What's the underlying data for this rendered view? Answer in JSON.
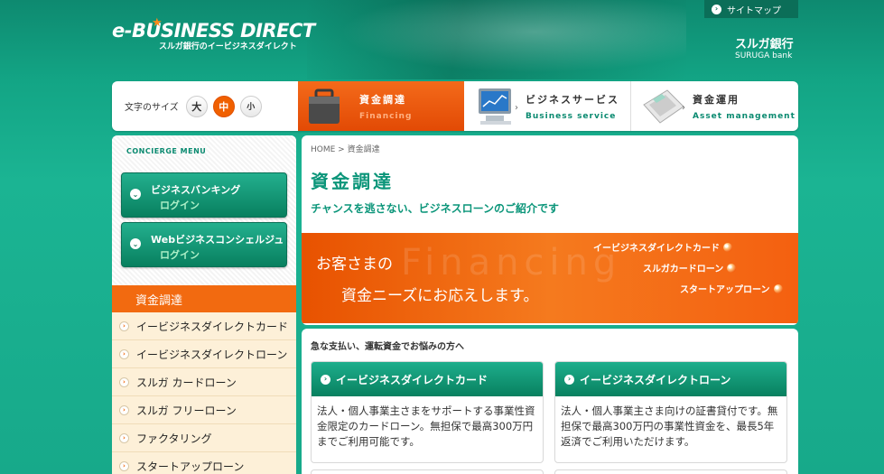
{
  "header": {
    "logo_main": "e-BUSINESS DIRECT",
    "logo_sub": "スルガ銀行のイービジネスダイレクト",
    "sitemap_label": "サイトマップ",
    "bank_name_jp": "スルガ銀行",
    "bank_name_en": "SURUGA bank"
  },
  "font_size": {
    "label": "文字のサイズ",
    "large": "大",
    "medium": "中",
    "small": "小",
    "selected": "中"
  },
  "nav": {
    "tabs": [
      {
        "jp": "資金調達",
        "en": "Financing",
        "active": true
      },
      {
        "jp": "ビジネスサービス",
        "en": "Business service",
        "active": false
      },
      {
        "jp": "資金運用",
        "en": "Asset management",
        "active": false
      }
    ]
  },
  "sidebar": {
    "concierge_title": "CONCIERGE MENU",
    "logins": [
      {
        "name": "ビジネスバンキング",
        "sub": "ログイン"
      },
      {
        "name": "Webビジネスコンシェルジュ",
        "sub": "ログイン"
      }
    ],
    "active_section": "資金調達",
    "items": [
      "イービジネスダイレクトカード",
      "イービジネスダイレクトローン",
      "スルガ カードローン",
      "スルガ フリーローン",
      "ファクタリング",
      "スタートアップローン"
    ]
  },
  "main": {
    "breadcrumb": "HOME > 資金調達",
    "title": "資金調達",
    "subtitle": "チャンスを逃さない、ビジネスローンのご紹介です",
    "banner": {
      "watermark": "Financing",
      "line1": "お客さまの",
      "line2": "資金ニーズにお応えします。",
      "links": [
        "イービジネスダイレクトカード",
        "スルガカードローン",
        "スタートアップローン"
      ]
    }
  },
  "products": {
    "heading": "急な支払い、運転資金でお悩みの方へ",
    "cards": [
      {
        "title": "イービジネスダイレクトカード",
        "body": "法人・個人事業主さまをサポートする事業性資金限定のカードローン。無担保で最高300万円までご利用可能です。"
      },
      {
        "title": "イービジネスダイレクトローン",
        "body": "法人・個人事業主さま向けの証書貸付です。無担保で最高300万円の事業性資金を、最長5年返済でご利用いただけます。"
      }
    ]
  },
  "colors": {
    "brand_green": "#0a9579",
    "accent_orange": "#f26a10"
  }
}
